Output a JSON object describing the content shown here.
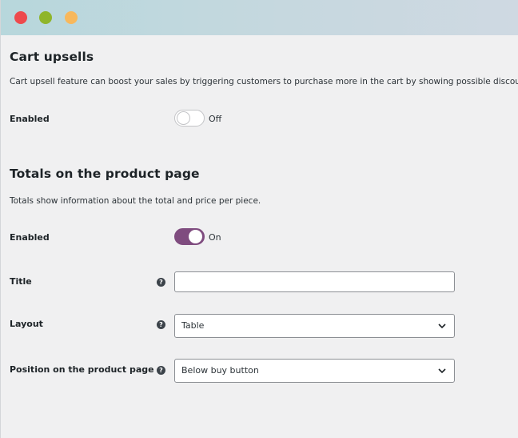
{
  "window": {
    "controls": [
      "close",
      "minimize",
      "maximize"
    ],
    "control_colors": {
      "close": "#ee4a4d",
      "minimize": "#8fb52a",
      "maximize": "#f8b85c"
    }
  },
  "cart_upsells": {
    "heading": "Cart upsells",
    "description": "Cart upsell feature can boost your sales by triggering customers to purchase more in the cart by showing possible discounts.",
    "enabled_label": "Enabled",
    "enabled_state": "Off"
  },
  "totals": {
    "heading": "Totals on the product page",
    "description": "Totals show information about the total and price per piece.",
    "enabled_label": "Enabled",
    "enabled_state": "On",
    "title_label": "Title",
    "title_value": "",
    "layout_label": "Layout",
    "layout_value": "Table",
    "position_label": "Position on the product page",
    "position_value": "Below buy button",
    "help_icon": "?"
  },
  "colors": {
    "toggle_on": "#7f4c7f"
  }
}
